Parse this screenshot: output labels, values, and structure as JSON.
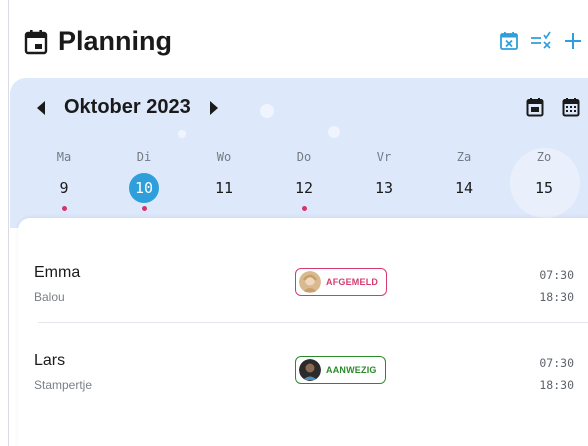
{
  "header": {
    "title": "Planning",
    "title_icon": "calendar-icon",
    "actions": [
      {
        "icon": "calendar-cancel-icon"
      },
      {
        "icon": "filter-clear-icon"
      },
      {
        "icon": "plus-icon"
      }
    ],
    "accent_color": "#2f9fdc"
  },
  "calendar": {
    "month_label": "Oktober 2023",
    "prev_icon": "caret-left-icon",
    "next_icon": "caret-right-icon",
    "view_icons": [
      "day-view-icon",
      "month-view-icon"
    ],
    "days": [
      {
        "name": "Ma",
        "num": "9",
        "dot": true,
        "selected": false
      },
      {
        "name": "Di",
        "num": "10",
        "dot": true,
        "selected": true
      },
      {
        "name": "Wo",
        "num": "11",
        "dot": false,
        "selected": false
      },
      {
        "name": "Do",
        "num": "12",
        "dot": true,
        "selected": false
      },
      {
        "name": "Vr",
        "num": "13",
        "dot": false,
        "selected": false
      },
      {
        "name": "Za",
        "num": "14",
        "dot": false,
        "selected": false
      },
      {
        "name": "Zo",
        "num": "15",
        "dot": false,
        "selected": false
      }
    ],
    "background_color": "#dde8fb",
    "dot_color": "#d4356c"
  },
  "entries": [
    {
      "name": "Emma",
      "group": "Balou",
      "status": "AFGEMELD",
      "status_color": "#d43c70",
      "start": "07:30",
      "end": "18:30"
    },
    {
      "name": "Lars",
      "group": "Stampertje",
      "status": "AANWEZIG",
      "status_color": "#2a8a2a",
      "start": "07:30",
      "end": "18:30"
    }
  ]
}
